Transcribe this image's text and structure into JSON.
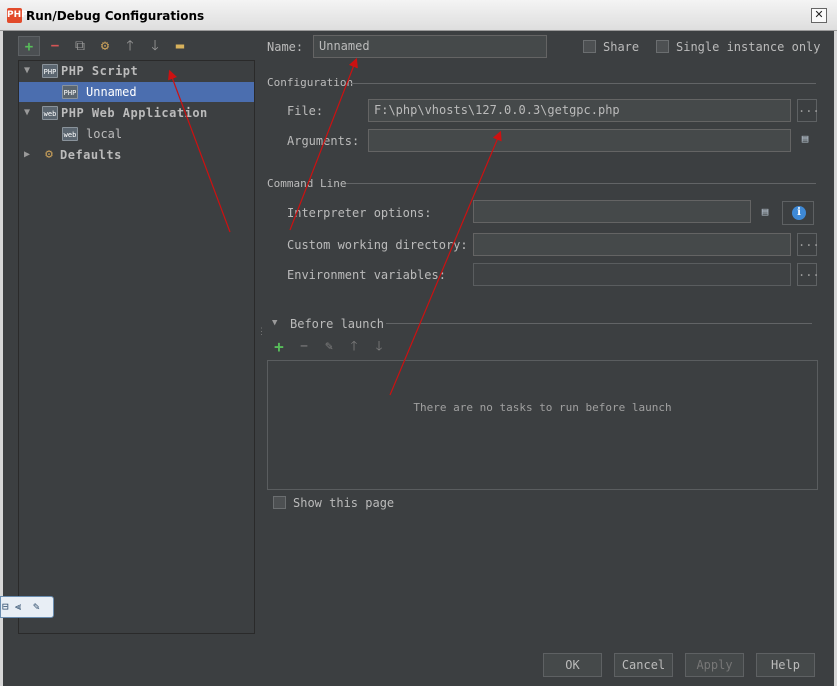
{
  "window": {
    "title": "Run/Debug Configurations",
    "close_glyph": "✕",
    "app_icon": "PHP"
  },
  "toolbar": {
    "add": "+",
    "remove": "−",
    "copy": "⧉",
    "edit_defaults": "⚙",
    "move_up": "🡑",
    "move_down": "🡓",
    "folder": "▬"
  },
  "tree": {
    "items": [
      {
        "label": "PHP Script",
        "arrow": "▼",
        "icon": "PHP"
      },
      {
        "label": "Unnamed",
        "icon": "PHP"
      },
      {
        "label": "PHP Web Application",
        "arrow": "▼",
        "icon": "web"
      },
      {
        "label": "local",
        "icon": "web"
      },
      {
        "label": "Defaults",
        "arrow": "▶",
        "icon": "⚙"
      }
    ]
  },
  "floating_toolbar": {
    "a": "⊟",
    "b": "⫷",
    "c": "✎"
  },
  "form": {
    "name_label": "Name:",
    "name_value": "Unnamed",
    "share_label": "Share",
    "single_instance_label": "Single instance only",
    "configuration_section": "Configuration",
    "file_label": "File:",
    "file_value": "F:\\php\\vhosts\\127.0.0.3\\getgpc.php",
    "arguments_label": "Arguments:",
    "arguments_value": "",
    "command_line_section": "Command Line",
    "interpreter_options_label": "Interpreter options:",
    "interpreter_options_value": "",
    "custom_working_dir_label": "Custom working directory:",
    "custom_working_dir_value": "",
    "env_vars_label": "Environment variables:",
    "env_vars_value": "",
    "dots": "...",
    "info": "i",
    "expand": "▤"
  },
  "before_launch": {
    "title": "Before launch",
    "collapse_arrow": "▼",
    "add": "+",
    "remove": "−",
    "edit": "✎",
    "up": "🡑",
    "down": "🡓",
    "empty_text": "There are no tasks to run before launch",
    "show_page_label": "Show this page"
  },
  "buttons": {
    "ok": "OK",
    "cancel": "Cancel",
    "apply": "Apply",
    "help": "Help"
  },
  "colors": {
    "background": "#3c3f41",
    "selection": "#4b6eaf",
    "annotation_arrow": "#cc1111"
  }
}
